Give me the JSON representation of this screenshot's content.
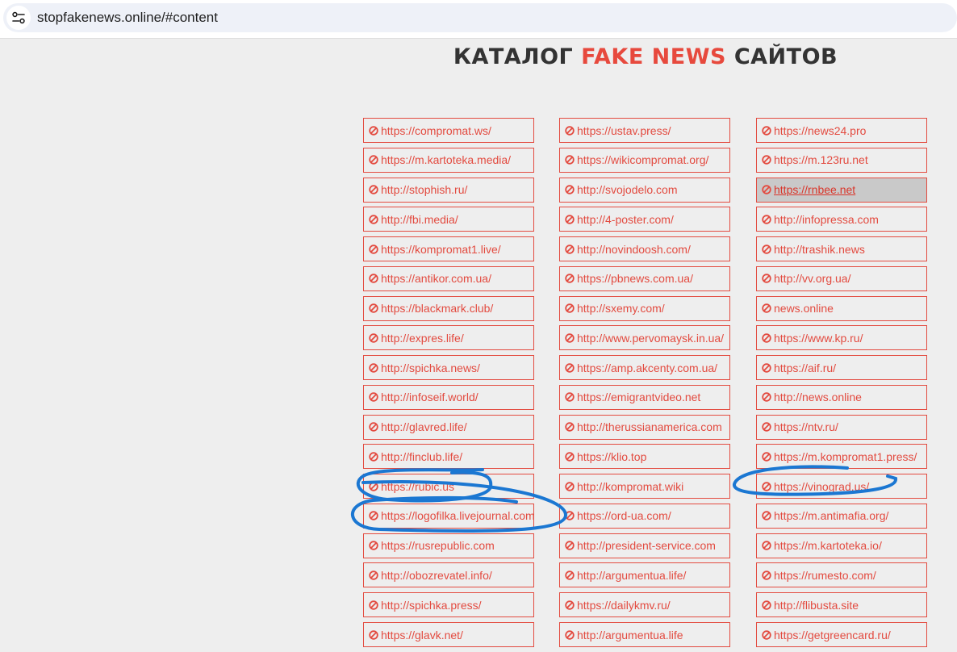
{
  "browser": {
    "url": "stopfakenews.online/#content",
    "site_info_icon": "tune-icon"
  },
  "title": {
    "part1": "КАТАЛОГ ",
    "part2": "FAKE NEWS",
    "part3": " САЙТОВ"
  },
  "colors": {
    "accent": "#e34b40",
    "annotation": "#1b77d2"
  },
  "columns": [
    [
      "https://compromat.ws/",
      "https://m.kartoteka.media/",
      "http://stophish.ru/",
      "http://fbi.media/",
      "https://kompromat1.live/",
      "https://antikor.com.ua/",
      "https://blackmark.club/",
      "http://expres.life/",
      "http://spichka.news/",
      "http://infoseif.world/",
      "http://glavred.life/",
      "http://finclub.life/",
      "https://rubic.us",
      "https://logofilka.livejournal.com",
      "https://rusrepublic.com",
      "http://obozrevatel.info/",
      "http://spichka.press/",
      "https://glavk.net/"
    ],
    [
      "https://ustav.press/",
      "https://wikicompromat.org/",
      "http://svojodelo.com",
      "http://4-poster.com/",
      "http://novindoosh.com/",
      "https://pbnews.com.ua/",
      "http://sxemy.com/",
      "http://www.pervomaysk.in.ua/",
      "https://amp.akcenty.com.ua/",
      "https://emigrantvideo.net",
      "http://therussianamerica.com",
      "https://klio.top",
      "http://kompromat.wiki",
      "https://ord-ua.com/",
      "http://president-service.com",
      "http://argumentua.life/",
      "https://dailykmv.ru/",
      "http://argumentua.life"
    ],
    [
      "https://news24.pro",
      "https://m.123ru.net",
      " https://rnbee.net",
      "http://infopressa.com",
      "http://trashik.news",
      "http://vv.org.ua/",
      "news.online",
      "https://www.kp.ru/",
      "https://aif.ru/",
      "http://news.online",
      "https://ntv.ru/",
      "https://m.kompromat1.press/",
      "https://vinograd.us/",
      "https://m.antimafia.org/",
      "https://m.kartoteka.io/",
      "https://rumesto.com/",
      "http://flibusta.site",
      "https://getgreencard.ru/"
    ]
  ],
  "hovered": {
    "column": 2,
    "row": 2
  },
  "link_icon": "ban-icon"
}
